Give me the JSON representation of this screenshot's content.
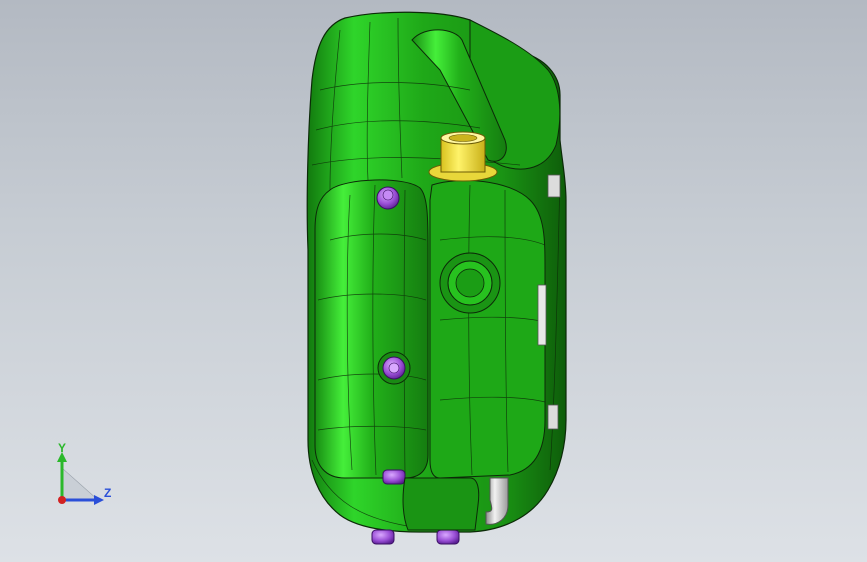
{
  "viewport": {
    "background_top": "#b3b9c2",
    "background_bottom": "#dde1e6"
  },
  "model": {
    "body_color": "#22b11a",
    "edge_color": "#0c2a08",
    "cap_color": "#f2e23a",
    "bolt_color": "#9a4fd6",
    "tube_color": "#cfcfcf"
  },
  "triad": {
    "y_label": "Y",
    "z_label": "Z",
    "y_color": "#2bb82b",
    "z_color": "#2a4fd8",
    "x_color": "#d22222"
  }
}
